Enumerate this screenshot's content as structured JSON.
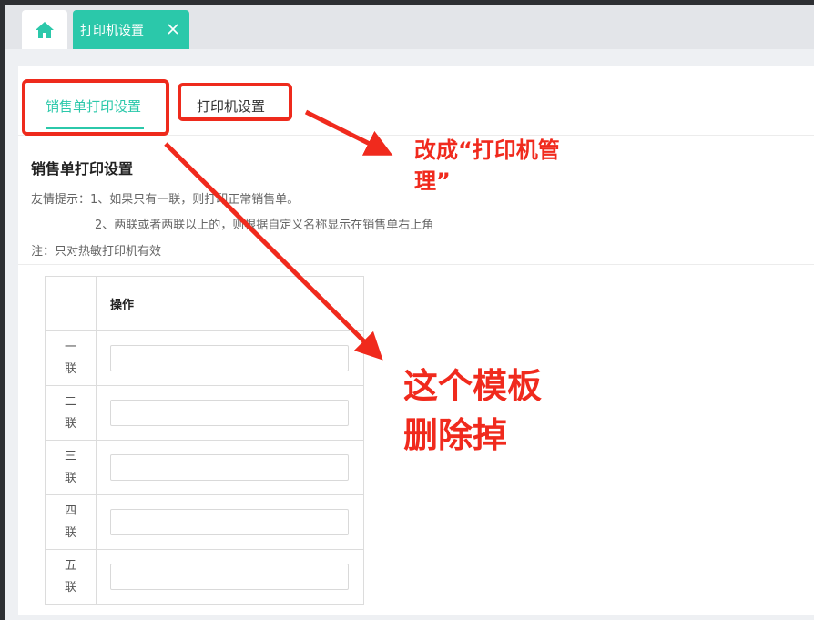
{
  "tabs": {
    "home_icon": "home-icon",
    "active_tab_label": "打印机设置",
    "close_icon": "close-icon"
  },
  "subtabs": [
    {
      "label": "销售单打印设置",
      "active": true
    },
    {
      "label": "打印机设置",
      "active": false
    }
  ],
  "section": {
    "title": "销售单打印设置",
    "hint_line1": "友情提示：1、如果只有一联，则打印正常销售单。",
    "hint_line2": "2、两联或者两联以上的，则根据自定义名称显示在销售单右上角",
    "note": "注：只对热敏打印机有效"
  },
  "table": {
    "header_action": "操作",
    "rows": [
      {
        "label": "一联",
        "value": ""
      },
      {
        "label": "二联",
        "value": ""
      },
      {
        "label": "三联",
        "value": ""
      },
      {
        "label": "四联",
        "value": ""
      },
      {
        "label": "五联",
        "value": ""
      }
    ]
  },
  "annotations": {
    "rename_note": "改成“打印机管理”",
    "delete_note_line1": "这个模板",
    "delete_note_line2": "删除掉"
  },
  "colors": {
    "accent": "#2bc8aa",
    "annotation_red": "#f02a1d"
  }
}
